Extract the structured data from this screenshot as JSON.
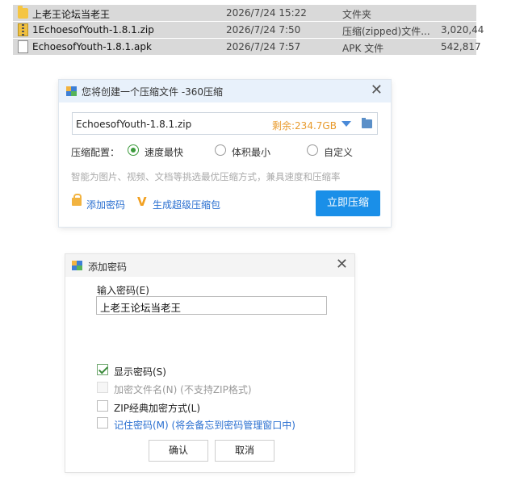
{
  "files": [
    {
      "name": "上老王论坛当老王",
      "date": "2026/7/24 15:22",
      "type": "文件夹",
      "size": "",
      "icon": "folder-icon"
    },
    {
      "name": "1EchoesofYouth-1.8.1.zip",
      "date": "2026/7/24 7:50",
      "type": "压缩(zipped)文件...",
      "size": "3,020,44",
      "icon": "zip-file-icon"
    },
    {
      "name": "EchoesofYouth-1.8.1.apk",
      "date": "2026/7/24 7:57",
      "type": "APK 文件",
      "size": "542,817",
      "icon": "file-icon"
    }
  ],
  "compress_dialog": {
    "title": "您将创建一个压缩文件 -360压缩",
    "close": "✕",
    "filename": "EchoesofYouth-1.8.1.zip",
    "free_space": "剩余:234.7GB",
    "config_label": "压缩配置：",
    "options": [
      {
        "label": "速度最快",
        "selected": true
      },
      {
        "label": "体积最小",
        "selected": false
      },
      {
        "label": "自定义",
        "selected": false
      }
    ],
    "hint": "智能为图片、视频、文档等挑选最优压缩方式，兼具速度和压缩率",
    "add_password": "添加密码",
    "super_pack": "生成超级压缩包",
    "compress_button": "立即压缩",
    "accent_color": "#1a8fe8"
  },
  "password_dialog": {
    "title": "添加密码",
    "close": "✕",
    "input_label": "输入密码(E)",
    "password_value": "上老王论坛当老王",
    "checkboxes": [
      {
        "label": "显示密码(S)",
        "checked": true,
        "enabled": true
      },
      {
        "label": "加密文件名(N) (不支持ZIP格式)",
        "checked": false,
        "enabled": false
      },
      {
        "label": "ZIP经典加密方式(L)",
        "checked": false,
        "enabled": true
      },
      {
        "label": "记住密码(M) (将会备忘到密码管理窗口中)",
        "checked": false,
        "enabled": true
      }
    ],
    "ok_button": "确认",
    "cancel_button": "取消"
  }
}
